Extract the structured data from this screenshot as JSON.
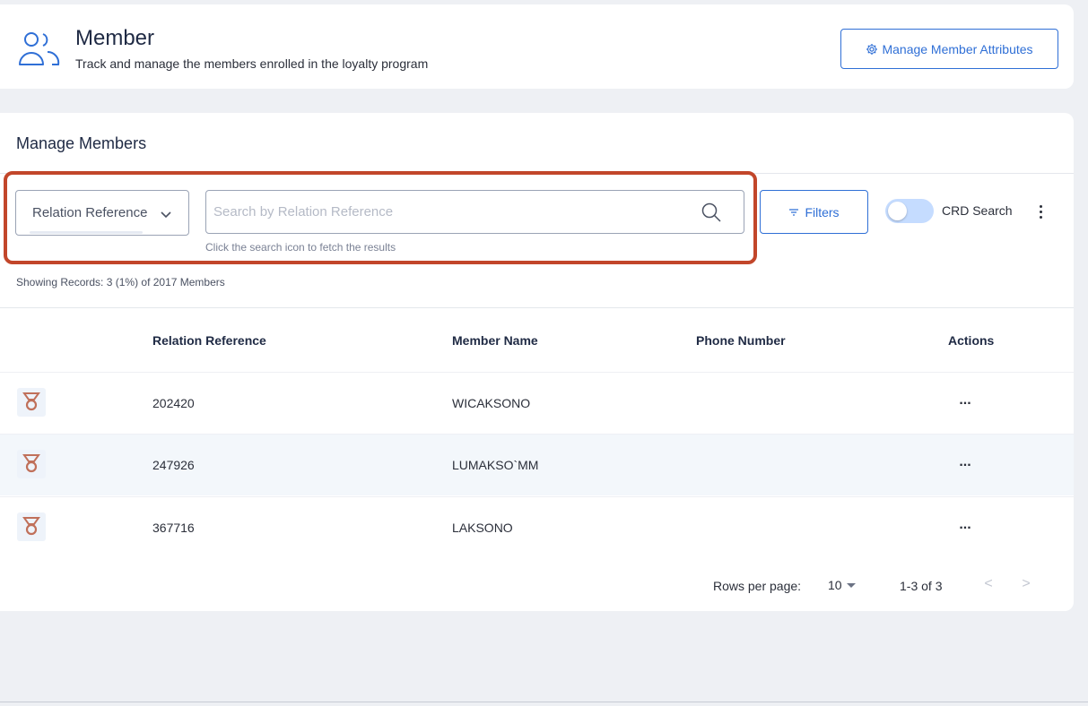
{
  "header": {
    "title": "Member",
    "subtitle": "Track and manage the members enrolled in the loyalty program",
    "manage_attributes_label": "Manage Member Attributes",
    "icon": "members-icon"
  },
  "manage": {
    "section_title": "Manage Members",
    "search_by": "Relation Reference",
    "search_placeholder": "Search by Relation Reference",
    "search_value": "",
    "helper_text": "Click the search icon to fetch the results",
    "filters_label": "Filters",
    "crd_search_label": "CRD Search",
    "crd_search_on": false,
    "showing_text": "Showing Records: 3 (1%) of 2017 Members"
  },
  "table": {
    "columns": [
      "Relation Reference",
      "Member Name",
      "Phone Number",
      "Actions"
    ],
    "rows": [
      {
        "tier_icon": "bronze-medal-icon",
        "relation_reference": "202420",
        "member_name": "WICAKSONO",
        "phone_number": "",
        "actions": "..."
      },
      {
        "tier_icon": "bronze-medal-icon",
        "relation_reference": "247926",
        "member_name": "LUMAKSO`MM",
        "phone_number": "",
        "actions": "..."
      },
      {
        "tier_icon": "bronze-medal-icon",
        "relation_reference": "367716",
        "member_name": "LAKSONO",
        "phone_number": "",
        "actions": "..."
      }
    ]
  },
  "pagination": {
    "rows_per_page_label": "Rows per page:",
    "rows_per_page": "10",
    "range": "1-3 of 3",
    "prev_label": "<",
    "next_label": ">"
  },
  "colors": {
    "accent": "#2f6fd6",
    "highlight": "#c2462a",
    "medal": "#c0705a"
  }
}
